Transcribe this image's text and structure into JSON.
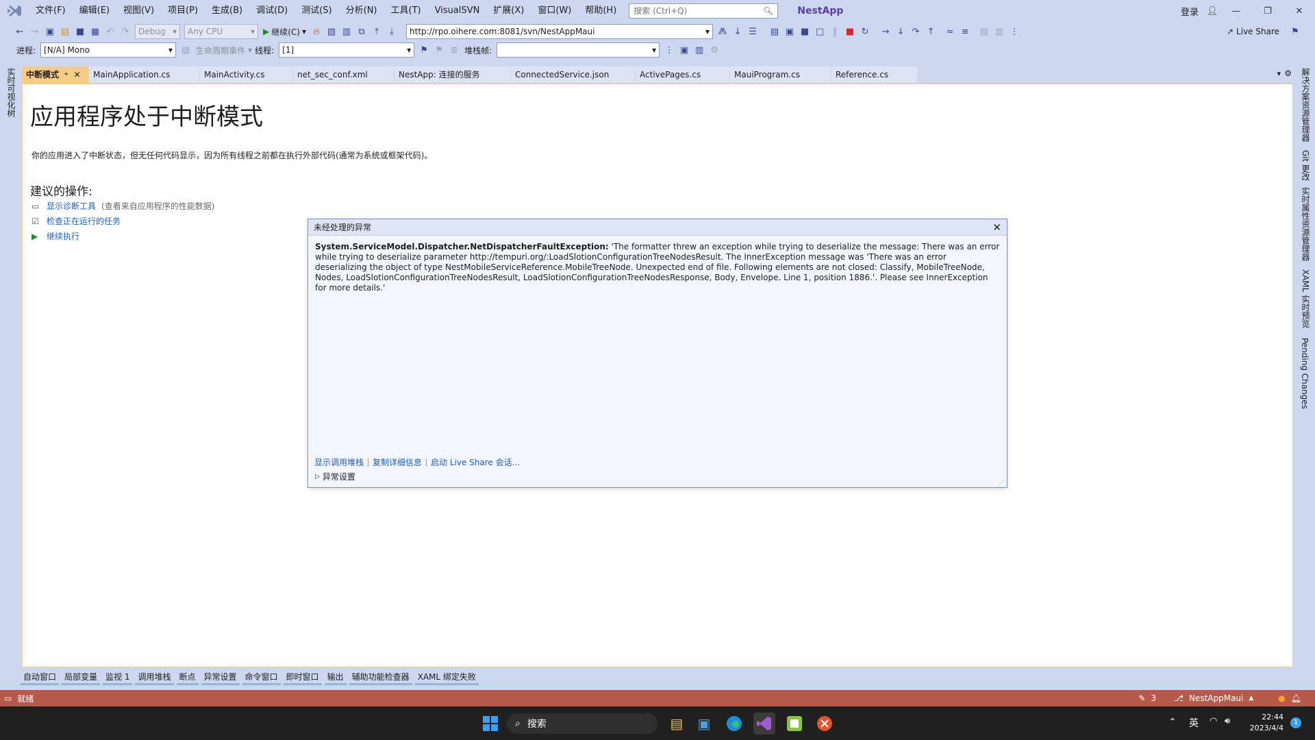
{
  "menu": {
    "items": [
      "文件(F)",
      "编辑(E)",
      "视图(V)",
      "项目(P)",
      "生成(B)",
      "调试(D)",
      "测试(S)",
      "分析(N)",
      "工具(T)",
      "VisualSVN",
      "扩展(X)",
      "窗口(W)",
      "帮助(H)"
    ],
    "search_placeholder": "搜索 (Ctrl+Q)",
    "app_title": "NestApp",
    "login": "登录"
  },
  "toolbar": {
    "config": "Debug",
    "platform": "Any CPU",
    "continue_label": "继续(C)",
    "url": "http://rpo.oihere.com:8081/svn/NestAppMaui",
    "live_share": "Live Share"
  },
  "toolbar2": {
    "process_label": "进程:",
    "process_value": "[N/A] Mono",
    "lifecycle_label": "生命周期事件",
    "thread_label": "线程:",
    "thread_value": "[1]",
    "stackframe_label": "堆栈帧:"
  },
  "tabs": {
    "active": "中断模式",
    "items": [
      "MainApplication.cs",
      "MainActivity.cs",
      "net_sec_conf.xml",
      "NestApp: 连接的服务",
      "ConnectedService.json",
      "ActivePages.cs",
      "MauiProgram.cs",
      "Reference.cs"
    ]
  },
  "page": {
    "title": "应用程序处于中断模式",
    "description": "你的应用进入了中断状态，但无任何代码显示，因为所有线程之前都在执行外部代码(通常为系统或框架代码)。",
    "suggested": "建议的操作:",
    "actions": [
      {
        "label": "显示诊断工具",
        "hint": "(查看来自应用程序的性能数据)"
      },
      {
        "label": "检查正在运行的任务",
        "hint": ""
      },
      {
        "label": "继续执行",
        "hint": ""
      }
    ]
  },
  "exception": {
    "title": "未经处理的异常",
    "type": "System.ServiceModel.Dispatcher.NetDispatcherFaultException:",
    "message": " 'The formatter threw an exception while trying to deserialize the message: There was an error while trying to deserialize parameter http://tempuri.org/:LoadSlotionConfigurationTreeNodesResult. The InnerException message was 'There was an error deserializing the object of type NestMobileServiceReference.MobileTreeNode. Unexpected end of file. Following elements are not closed: Classify, MobileTreeNode, Nodes, LoadSlotionConfigurationTreeNodesResult, LoadSlotionConfigurationTreeNodesResponse, Body, Envelope. Line 1, position 1886.'.  Please see InnerException for more details.'",
    "links": [
      "显示调用堆栈",
      "复制详细信息",
      "启动 Live Share 会话..."
    ],
    "settings": "异常设置"
  },
  "right_tabs": [
    "解决方案资源管理器",
    "Git 更改",
    "实时属性资源管理器",
    "XAML 实时预览",
    "Pending Changes"
  ],
  "left_tabs": [
    "实时可视化树"
  ],
  "bottom_tabs": [
    "自动窗口",
    "局部变量",
    "监视 1",
    "调用堆栈",
    "断点",
    "异常设置",
    "命令窗口",
    "即时窗口",
    "输出",
    "辅助功能检查器",
    "XAML 绑定失败"
  ],
  "status": {
    "ready": "就绪",
    "edits": "3",
    "branch": "NestAppMaui"
  },
  "taskbar": {
    "search": "搜索",
    "ime": "英",
    "time": "22:44",
    "date": "2023/4/4",
    "notifications": "1"
  },
  "colors": {
    "accent_tab": "#f5cc84",
    "statusbar": "#b75a4d",
    "chrome": "#ced7f0",
    "link": "#1a5dbb"
  }
}
